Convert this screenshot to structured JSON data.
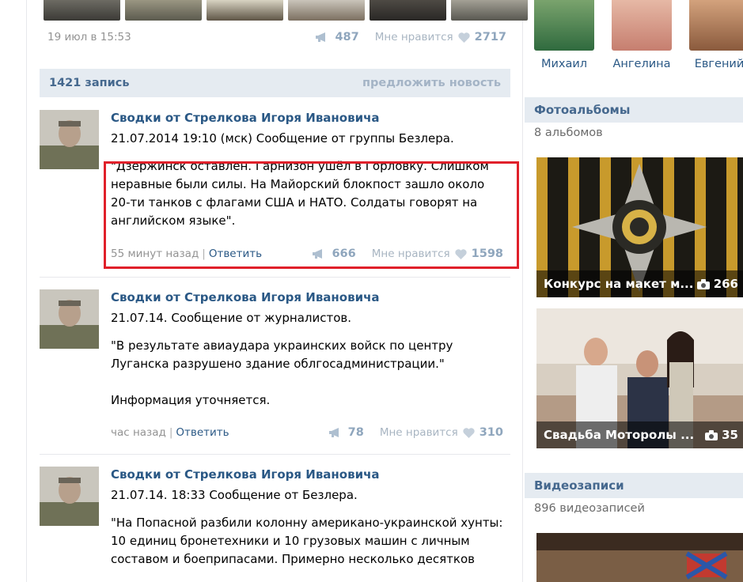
{
  "top_post": {
    "date": "19 июл в 15:53",
    "shares": "487",
    "like_label": "Мне нравится",
    "likes": "2717"
  },
  "wall": {
    "count_label": "1421 запись",
    "suggest_label": "предложить новость"
  },
  "posts": [
    {
      "author": "Сводки от Стрелкова Игоря Ивановича",
      "lines": [
        "21.07.2014 19:10 (мск) Сообщение от группы Безлера.",
        "",
        "\"Дзержинск оставлен. Гарнизон ушёл в Горловку. Слишком",
        "неравные были силы. На Майорский блокпост зашло около",
        "20-ти танков с флагами США и НАТО. Солдаты говорят на",
        "английском языке\"."
      ],
      "time": "55 минут назад",
      "reply_label": "Ответить",
      "shares": "666",
      "like_label": "Мне нравится",
      "likes": "1598"
    },
    {
      "author": "Сводки от Стрелкова Игоря Ивановича",
      "lines": [
        "21.07.14. Сообщение от журналистов.",
        "",
        "\"В результате авиаудара украинских войск по центру",
        "Луганска разрушено здание облгосадминистрации.\"",
        "",
        "Информация уточняется."
      ],
      "time": "час назад",
      "reply_label": "Ответить",
      "shares": "78",
      "like_label": "Мне нравится",
      "likes": "310"
    },
    {
      "author": "Сводки от Стрелкова Игоря Ивановича",
      "lines": [
        "21.07.14. 18:33 Сообщение от Безлера.",
        "",
        "\"На Попасной разбили колонну американо-украинской хунты:",
        "10 единиц бронетехники и 10 грузовых машин с личным",
        "составом и боеприпасами. Примерно несколько десятков"
      ]
    }
  ],
  "friends": [
    {
      "name": "Михаил"
    },
    {
      "name": "Ангелина"
    },
    {
      "name": "Евгений"
    }
  ],
  "photo_albums": {
    "title": "Фотоальбомы",
    "subtitle": "8 альбомов",
    "items": [
      {
        "title": "Конкурс на макет м...",
        "count": "266"
      },
      {
        "title": "Свадьба Моторолы ...",
        "count": "35"
      }
    ]
  },
  "videos": {
    "title": "Видеозаписи",
    "subtitle": "896 видеозаписей"
  },
  "colors": {
    "link": "#2a5885",
    "header_bg": "#e5ebf1",
    "highlight_border": "#e0202a"
  }
}
